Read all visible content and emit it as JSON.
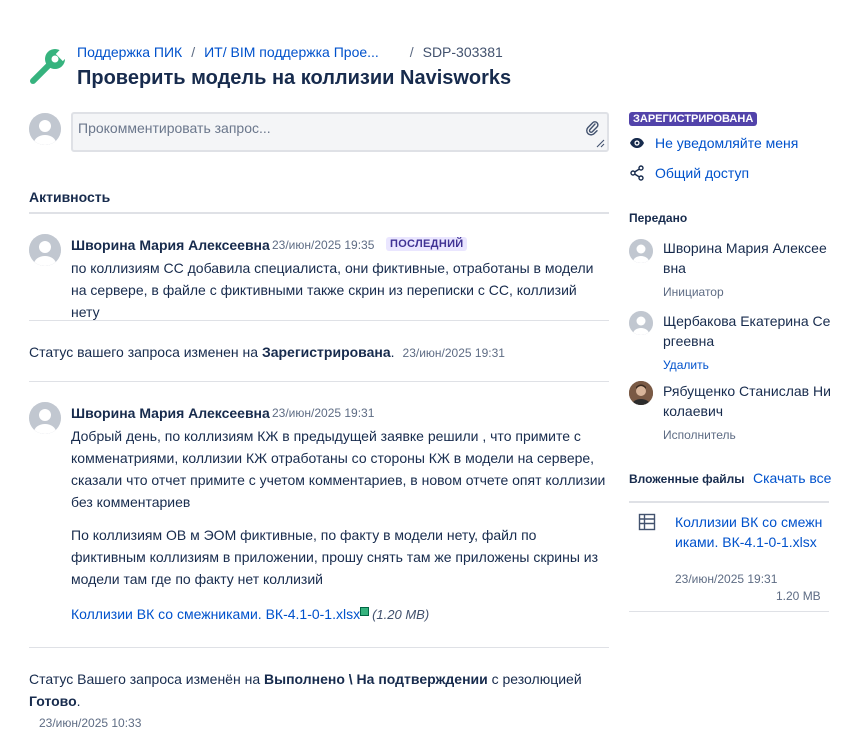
{
  "breadcrumb": {
    "project": "Поддержка ПИК",
    "portal": "ИТ/ BIM поддержка Прое...",
    "key": "SDP-303381"
  },
  "title": "Проверить модель на коллизии Navisworks",
  "comment_input": {
    "placeholder": "Прокомментировать запрос..."
  },
  "activity": {
    "heading": "Активность",
    "comment1": {
      "author": "Шворина Мария Алексеевна",
      "time": "23/июн/2025 19:35",
      "badge": "ПОСЛЕДНИЙ",
      "text": "по коллизиям СС добавила специалиста, они фиктивные, отработаны в модели на сервере, в файле с фиктивными также скрин из переписки с СС, коллизий нету"
    },
    "status1": {
      "prefix": "Статус вашего запроса изменен на ",
      "value": "Зарегистрирована",
      "suffix": ".",
      "time": "23/июн/2025 19:31"
    },
    "comment2": {
      "author": "Шворина Мария Алексеевна",
      "time": "23/июн/2025 19:31",
      "para1": "Добрый день, по коллизиям КЖ в предыдущей заявке решили , что примите с комменатриями, коллизии КЖ отработаны со стороны КЖ в модели на сервере, сказали что отчет примите с учетом комментариев, в новом отчете опят коллизии без комментариев",
      "para2": "По коллизиям ОВ м ЭОМ фиктивные, по факту в модели нету, файл по фиктивным коллизиям в приложении, прошу снять там же приложены скрины из модели там где по факту нет коллизий",
      "attachment": "Коллизии ВК со смежниками. ВК-4.1-0-1.xlsx",
      "attachment_size": "(1.20 MB)"
    },
    "status2": {
      "prefix": "Статус Вашего запроса изменён на ",
      "value": "Выполнено \\ На подтверждении",
      "mid": " с резолюцией",
      "resolution": "Готово",
      "suffix": ".",
      "time": "23/июн/2025 10:33"
    }
  },
  "sidebar": {
    "status": "ЗАРЕГИСТРИРОВАНА",
    "notify": "Не уведомляйте меня",
    "share": "Общий доступ",
    "shared_heading": "Передано",
    "participants": [
      {
        "name": "Шворина Мария Алексеевна",
        "role": "Инициатор"
      },
      {
        "name": "Щербакова Екатерина Сергеевна",
        "action": "Удалить"
      },
      {
        "name": "Рябущенко Станислав Николаевич",
        "role": "Исполнитель"
      }
    ],
    "files_heading": "Вложенные файлы",
    "download_all": "Скачать все",
    "file": {
      "name": "Коллизии ВК со смежниками. ВК-4.1-0-1.xlsx",
      "date": "23/июн/2025 19:31",
      "size": "1.20 MB"
    }
  },
  "colors": {
    "link": "#0052cc",
    "text": "#172b4d",
    "muted": "#5e6c84",
    "status_lozenge": "#5243aa",
    "latest_badge_bg": "#eae6ff",
    "logo": "#36b37e"
  }
}
